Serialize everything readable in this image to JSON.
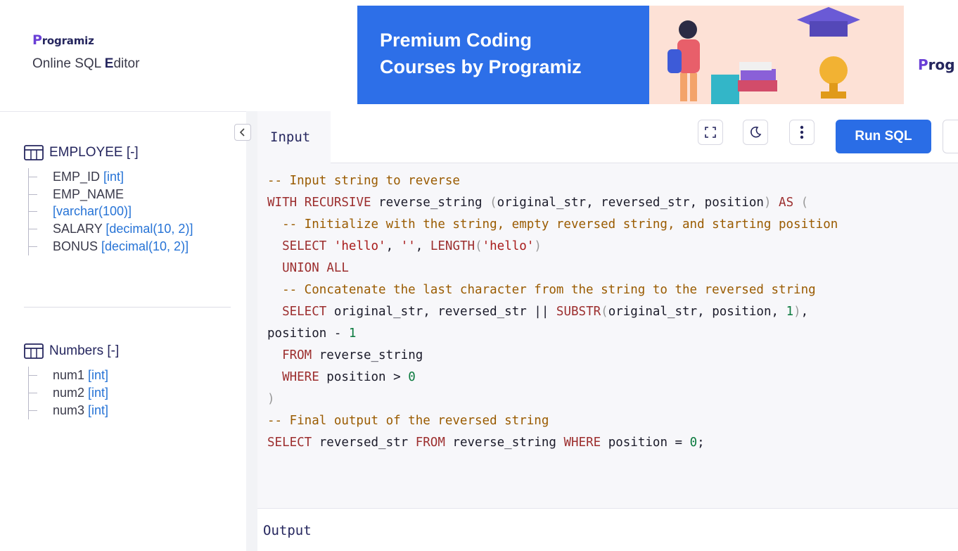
{
  "header": {
    "logo_initial": "P",
    "logo_rest": "rogramiz",
    "subtitle": "Online SQL Editor",
    "banner": {
      "line1": "Premium Coding",
      "line2": "Courses by Programiz",
      "logo_initial": "P",
      "logo_rest": "rog",
      "colors": {
        "blue": "#2d6fe8",
        "pink": "#fde1d6"
      }
    }
  },
  "sidebar": {
    "collapse_icon": "chevron-left-icon",
    "tables": [
      {
        "name": "EMPLOYEE [-]",
        "columns": [
          {
            "name": "EMP_ID ",
            "type": "[int]"
          },
          {
            "name": "EMP_NAME",
            "type": ""
          },
          {
            "name": "",
            "type": "[varchar(100)]"
          },
          {
            "name": "SALARY ",
            "type": "[decimal(10, 2)]"
          },
          {
            "name": "BONUS ",
            "type": "[decimal(10, 2)]"
          }
        ]
      },
      {
        "name": "Numbers [-]",
        "columns": [
          {
            "name": "num1 ",
            "type": "[int]"
          },
          {
            "name": "num2 ",
            "type": "[int]"
          },
          {
            "name": "num3 ",
            "type": "[int]"
          }
        ]
      }
    ]
  },
  "editor": {
    "tab_label": "Input",
    "toolbar": {
      "fullscreen_icon": "fullscreen-icon",
      "theme_icon": "moon-icon",
      "menu_icon": "kebab-menu-icon",
      "run_label": "Run SQL",
      "run_color": "#2a6de6"
    },
    "code_lines": [
      "-- Input string to reverse",
      "WITH RECURSIVE reverse_string (original_str, reversed_str, position) AS (",
      "  -- Initialize with the string, empty reversed string, and starting position",
      "  SELECT 'hello', '', LENGTH('hello')",
      "  UNION ALL",
      "  -- Concatenate the last character from the string to the reversed string",
      "  SELECT original_str, reversed_str || SUBSTR(original_str, position, 1),",
      "position - 1",
      "  FROM reverse_string",
      "  WHERE position > 0",
      ")",
      "-- Final output of the reversed string",
      "SELECT reversed_str FROM reverse_string WHERE position = 0;"
    ],
    "output_label": "Output"
  }
}
